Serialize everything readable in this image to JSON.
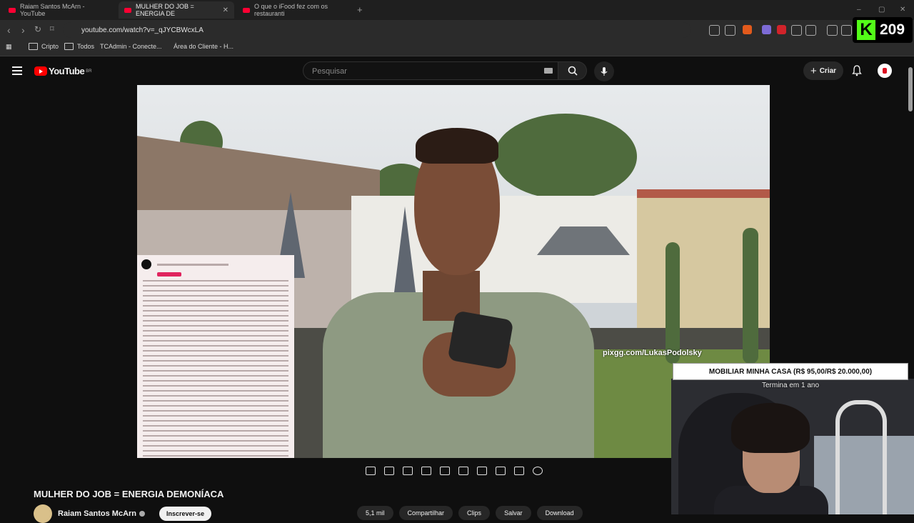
{
  "browser": {
    "tabs": [
      {
        "label": "Raiam Santos McArn - YouTube"
      },
      {
        "label": "MULHER DO JOB = ENERGIA DE"
      },
      {
        "label": "O que o iFood fez com os restauranti"
      }
    ],
    "url": "youtube.com/watch?v=_qJYCBWcxLA",
    "bookmarks": [
      "Cripto",
      "Todos",
      "TCAdmin - Conecte...",
      "Área do Cliente - H..."
    ]
  },
  "kick": {
    "viewer_count": "209"
  },
  "youtube": {
    "logo_text": "YouTube",
    "region": "BR",
    "search_placeholder": "Pesquisar",
    "create_label": "Criar"
  },
  "overlay": {
    "watermark": "pixgg.com/LukasPodolsky",
    "goal_title": "MOBILIAR MINHA CASA (R$ 95,00/R$ 20.000,00)",
    "goal_subtitle": "Termina em 1 ano"
  },
  "video": {
    "title": "MULHER DO JOB = ENERGIA DEMONÍACA",
    "channel": "Raiam Santos McArn",
    "subscribe_label": "Inscrever-se",
    "actions": [
      "5,1 mil",
      "Compartilhar",
      "Clips",
      "Salvar",
      "Download"
    ]
  },
  "colors": {
    "youtube_red": "#ff0000",
    "kick_green": "#53fc18",
    "background": "#0f0f0f"
  }
}
